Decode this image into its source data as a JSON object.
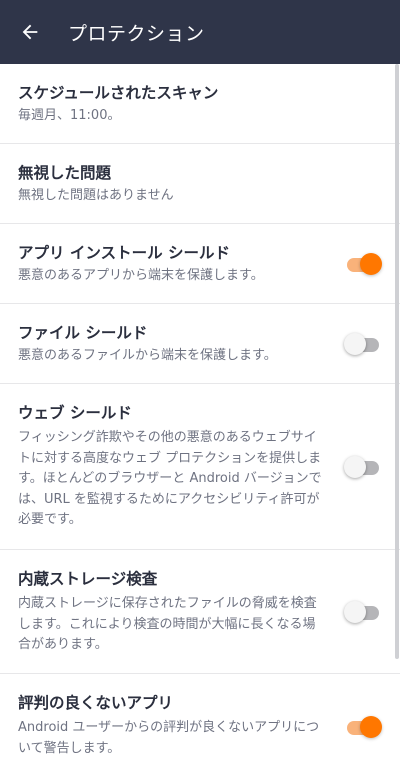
{
  "header": {
    "title": "プロテクション",
    "back_icon": "arrow-left-icon",
    "background": "#2f3549"
  },
  "accent_color": "#ff7700",
  "items": [
    {
      "title": "スケジュールされたスキャン",
      "desc": "毎週月、11:00。"
    },
    {
      "title": "無視した問題",
      "desc": "無視した問題はありません"
    },
    {
      "title": "アプリ インストール シールド",
      "desc": "悪意のあるアプリから端末を保護します。",
      "enabled": true
    },
    {
      "title": "ファイル シールド",
      "desc": "悪意のあるファイルから端末を保護します。",
      "enabled": false
    },
    {
      "title": "ウェブ シールド",
      "desc": "フィッシング詐欺やその他の悪意のあるウェブサイトに対する高度なウェブ プロテクションを提供します。ほとんどのブラウザーと Android バージョンでは、URL を監視するためにアクセシビリティ許可が必要です。",
      "enabled": false
    },
    {
      "title": "内蔵ストレージ検査",
      "desc": "内蔵ストレージに保存されたファイルの脅威を検査します。これにより検査の時間が大幅に長くなる場合があります。",
      "enabled": false
    },
    {
      "title": "評判の良くないアプリ",
      "desc": "Android ユーザーからの評判が良くないアプリについて警告します。",
      "enabled": true
    }
  ]
}
